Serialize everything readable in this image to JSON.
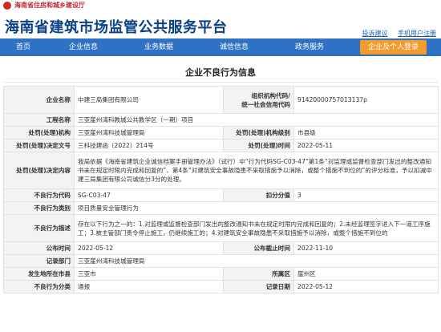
{
  "topbar": {
    "dept": "海南省住房和城乡建设厅"
  },
  "header": {
    "title": "海南省建筑市场监管公共服务平台",
    "links": [
      "投诉建议",
      "手机用户注册"
    ]
  },
  "nav": {
    "items": [
      "首页",
      "企业信息",
      "业务数据",
      "诚信信息",
      "政务服务"
    ],
    "cta": "企业及个人登录"
  },
  "page": {
    "title": "企业不良行为信息",
    "fields": {
      "company_name_label": "企业名称",
      "company_name": "中建三局集团有限公司",
      "org_code_label_1": "组织机构代码/",
      "org_code_label_2": "统一社会信用代码",
      "org_code": "91420000757013137p",
      "project_label": "工程名称",
      "project": "三亚崖州湾科教城公共教学区（一期）项目",
      "handler_label": "处罚(处理)机构",
      "handler": "三亚崖州湾科技城管理局",
      "handler_level_label": "处罚(处理)机构级别",
      "handler_level": "市县级",
      "decision_no_label": "处罚(处理)决定文号",
      "decision_no": "三科技建函〔2022〕214号",
      "decision_date_label": "处罚(处理)时间",
      "decision_date": "2022-05-11",
      "decision_content_label": "处罚(处理)决定内容",
      "decision_content": "我局依据《海南省建筑企业诚信档案手册管理办法》（试行）中“行为代码SG-C03-47”第1条“对监理或监督检查部门发出的整改通知书未在规定时限内完成和回复的”、第4条“对建筑安全事故隐患不采取措施予以消除，或整个措施不到位的”的评分标准，予以扣减中建三局集团有限公司诚信分3分的处理。",
      "code_label": "不良行为代码",
      "code": "SG-C03-47",
      "deduct_label": "扣分分值",
      "deduct": "3",
      "category_label": "不良行为类别",
      "category": "项目质量安全管理行为",
      "desc_label": "不良行为描述",
      "desc": "存在以下行为之一的：1.对监理或监督检查部门发出的整改通知书未在规定时限内完成和回复的；2.未经监理签字进入下一道工序施工；3.被主管部门责令停止施工，仍继续施工的；4.对建筑安全事故隐患不采取措施予以消除，或整个措施不到位的",
      "publish_date_label": "公布时间",
      "publish_date": "2022-05-12",
      "publish_end_label": "公布截止时间",
      "publish_end": "2022-11-10",
      "recorder_label": "记录部门",
      "recorder": "三亚崖州湾科技城管理局",
      "city_label": "发生地所在市县",
      "city": "三亚市",
      "district_label": "所属区",
      "district": "崖州区",
      "type_label": "不良行为分类",
      "type": "通报",
      "record_date_label": "记录日期",
      "record_date": "2022-05-12"
    }
  },
  "colors": {
    "nav_bg": "#2f72c4",
    "title_blue": "#0b3f86",
    "cta_orange": "#f39b2c",
    "dept_red": "#c1272d"
  }
}
